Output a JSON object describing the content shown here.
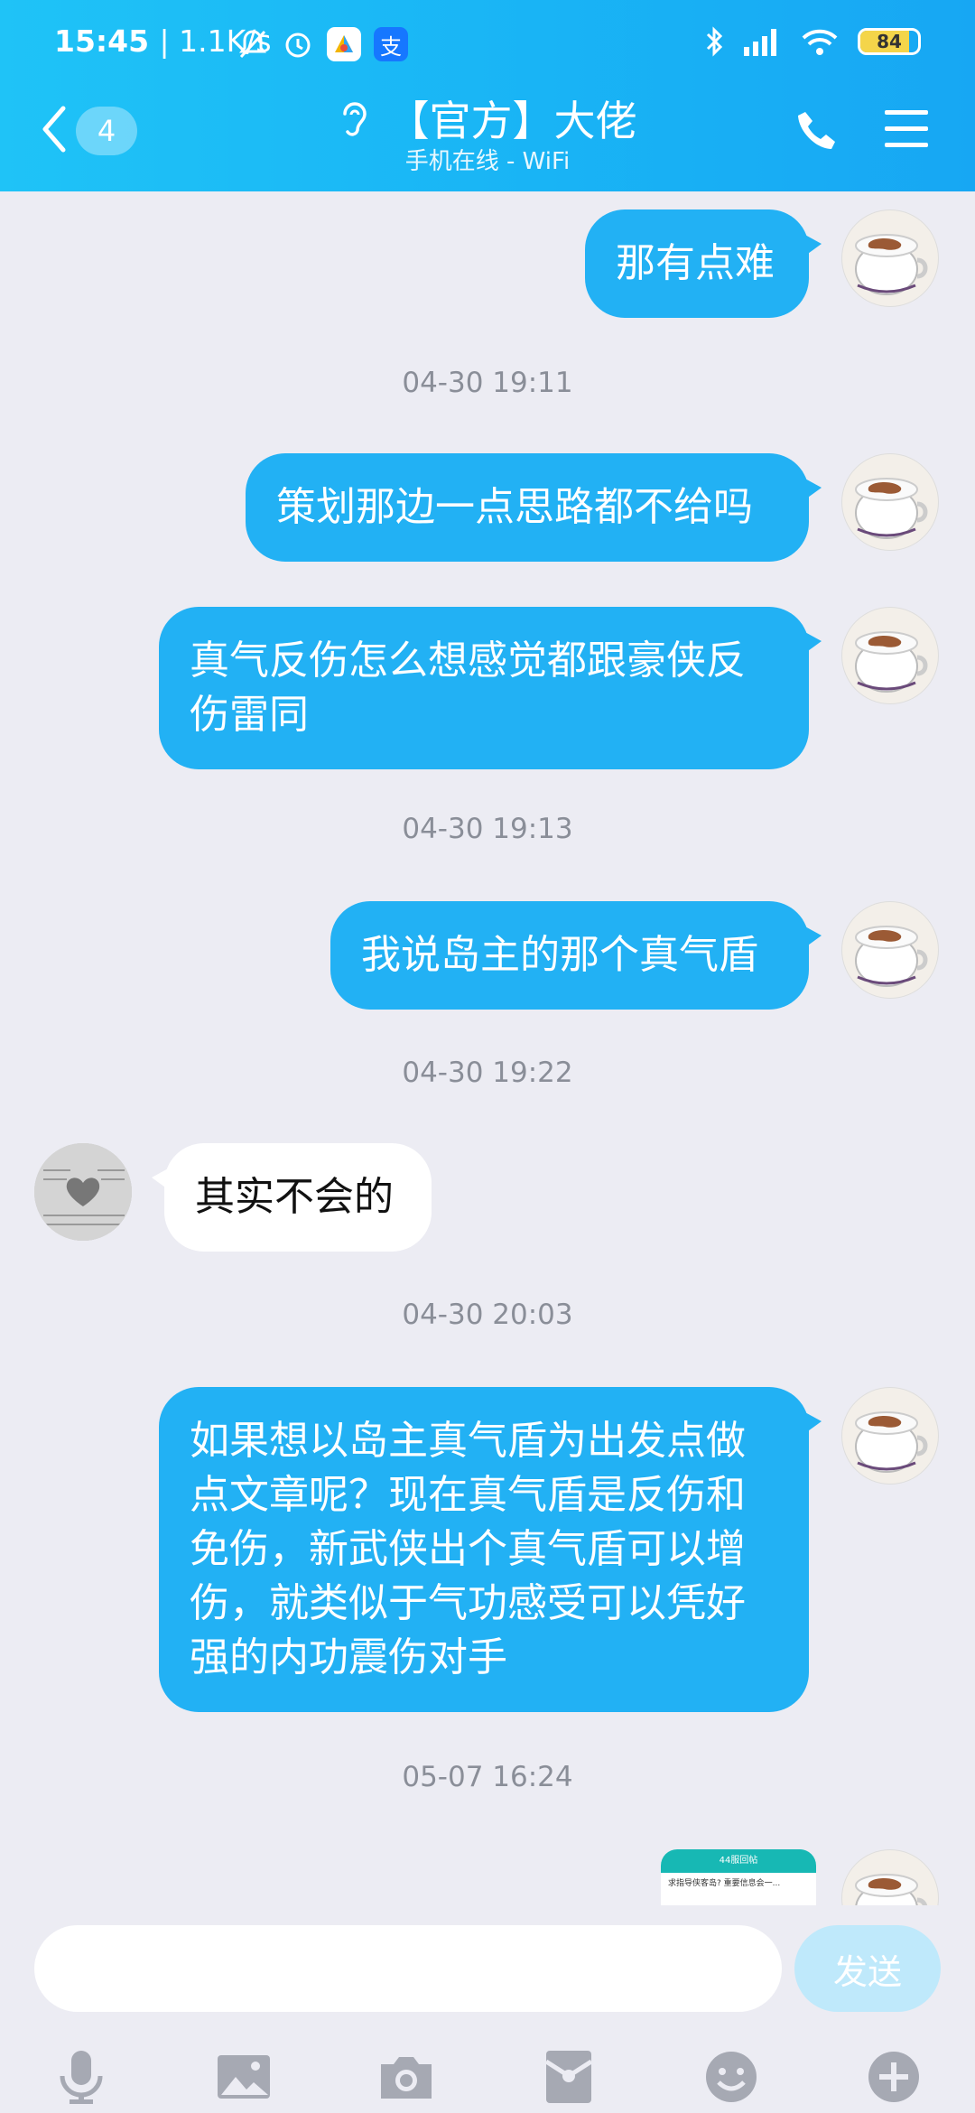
{
  "status_bar": {
    "time": "15:45",
    "net_speed": "| 1.1K/s",
    "battery": 84
  },
  "header": {
    "unread_count": "4",
    "title": "【官方】大佬",
    "subtitle": "手机在线 - WiFi"
  },
  "messages": [
    {
      "type": "out",
      "text": "那有点难"
    },
    {
      "type": "time",
      "text": "04-30 19:11"
    },
    {
      "type": "out",
      "text": "策划那边一点思路都不给吗"
    },
    {
      "type": "out",
      "text": "真气反伤怎么想感觉都跟豪侠反伤雷同"
    },
    {
      "type": "time",
      "text": "04-30 19:13"
    },
    {
      "type": "out",
      "text": "我说岛主的那个真气盾"
    },
    {
      "type": "time",
      "text": "04-30 19:22"
    },
    {
      "type": "in",
      "text": "其实不会的"
    },
    {
      "type": "time",
      "text": "04-30 20:03"
    },
    {
      "type": "out",
      "text": "如果想以岛主真气盾为出发点做点文章呢？现在真气盾是反伤和免伤，新武侠出个真气盾可以增伤，就类似于气功感受可以凭好强的内功震伤对手"
    },
    {
      "type": "time",
      "text": "05-07 16:24"
    },
    {
      "type": "image",
      "title": "44服回帖",
      "line": "求指导侠客岛? 重要信息会一..."
    }
  ],
  "input": {
    "value": "",
    "send_label": "发送"
  },
  "toolbar": [
    "mic-icon",
    "image-icon",
    "camera-icon",
    "red-packet-icon",
    "emoji-icon",
    "plus-icon"
  ],
  "colors": {
    "header": "#1fc3f7",
    "bubble_out": "#22b1f4",
    "bubble_in": "#ffffff",
    "send_disabled": "#bfe9fb"
  }
}
